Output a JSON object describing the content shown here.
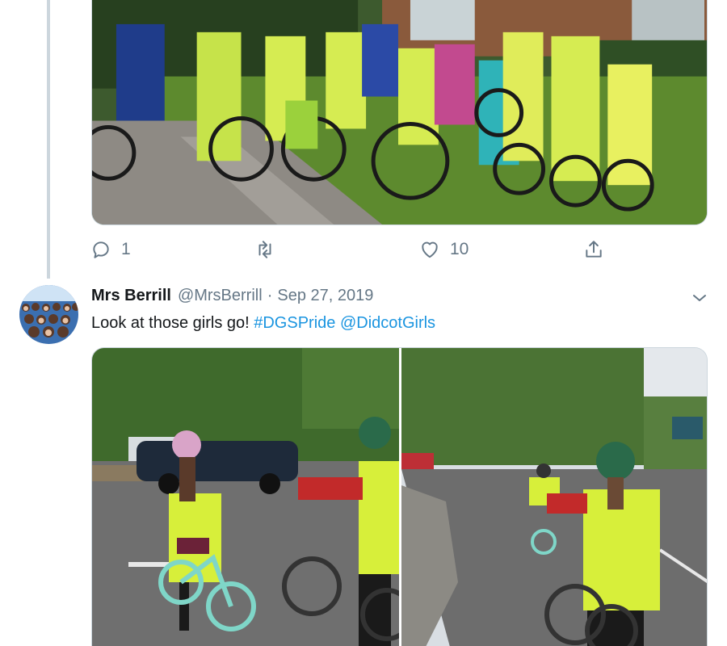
{
  "tweet1": {
    "media_alt": "Group of girls and adults with bicycles wearing hi-vis vests",
    "actions": {
      "reply_count": "1",
      "retweet_count": "",
      "like_count": "10"
    }
  },
  "tweet2": {
    "display_name": "Mrs Berrill",
    "handle": "@MrsBerrill",
    "separator": "·",
    "date": "Sep 27, 2019",
    "text_prefix": "Look at those girls go! ",
    "hashtag": "#DGSPride",
    "mention": "@DidcotGirls"
  },
  "icons": [
    "reply-icon",
    "retweet-icon",
    "like-icon",
    "share-icon",
    "chevron-down-icon"
  ],
  "colors": {
    "link": "#1b95e0",
    "secondary_text": "#657786",
    "primary_text": "#14171a",
    "border": "#ccd6dd"
  }
}
